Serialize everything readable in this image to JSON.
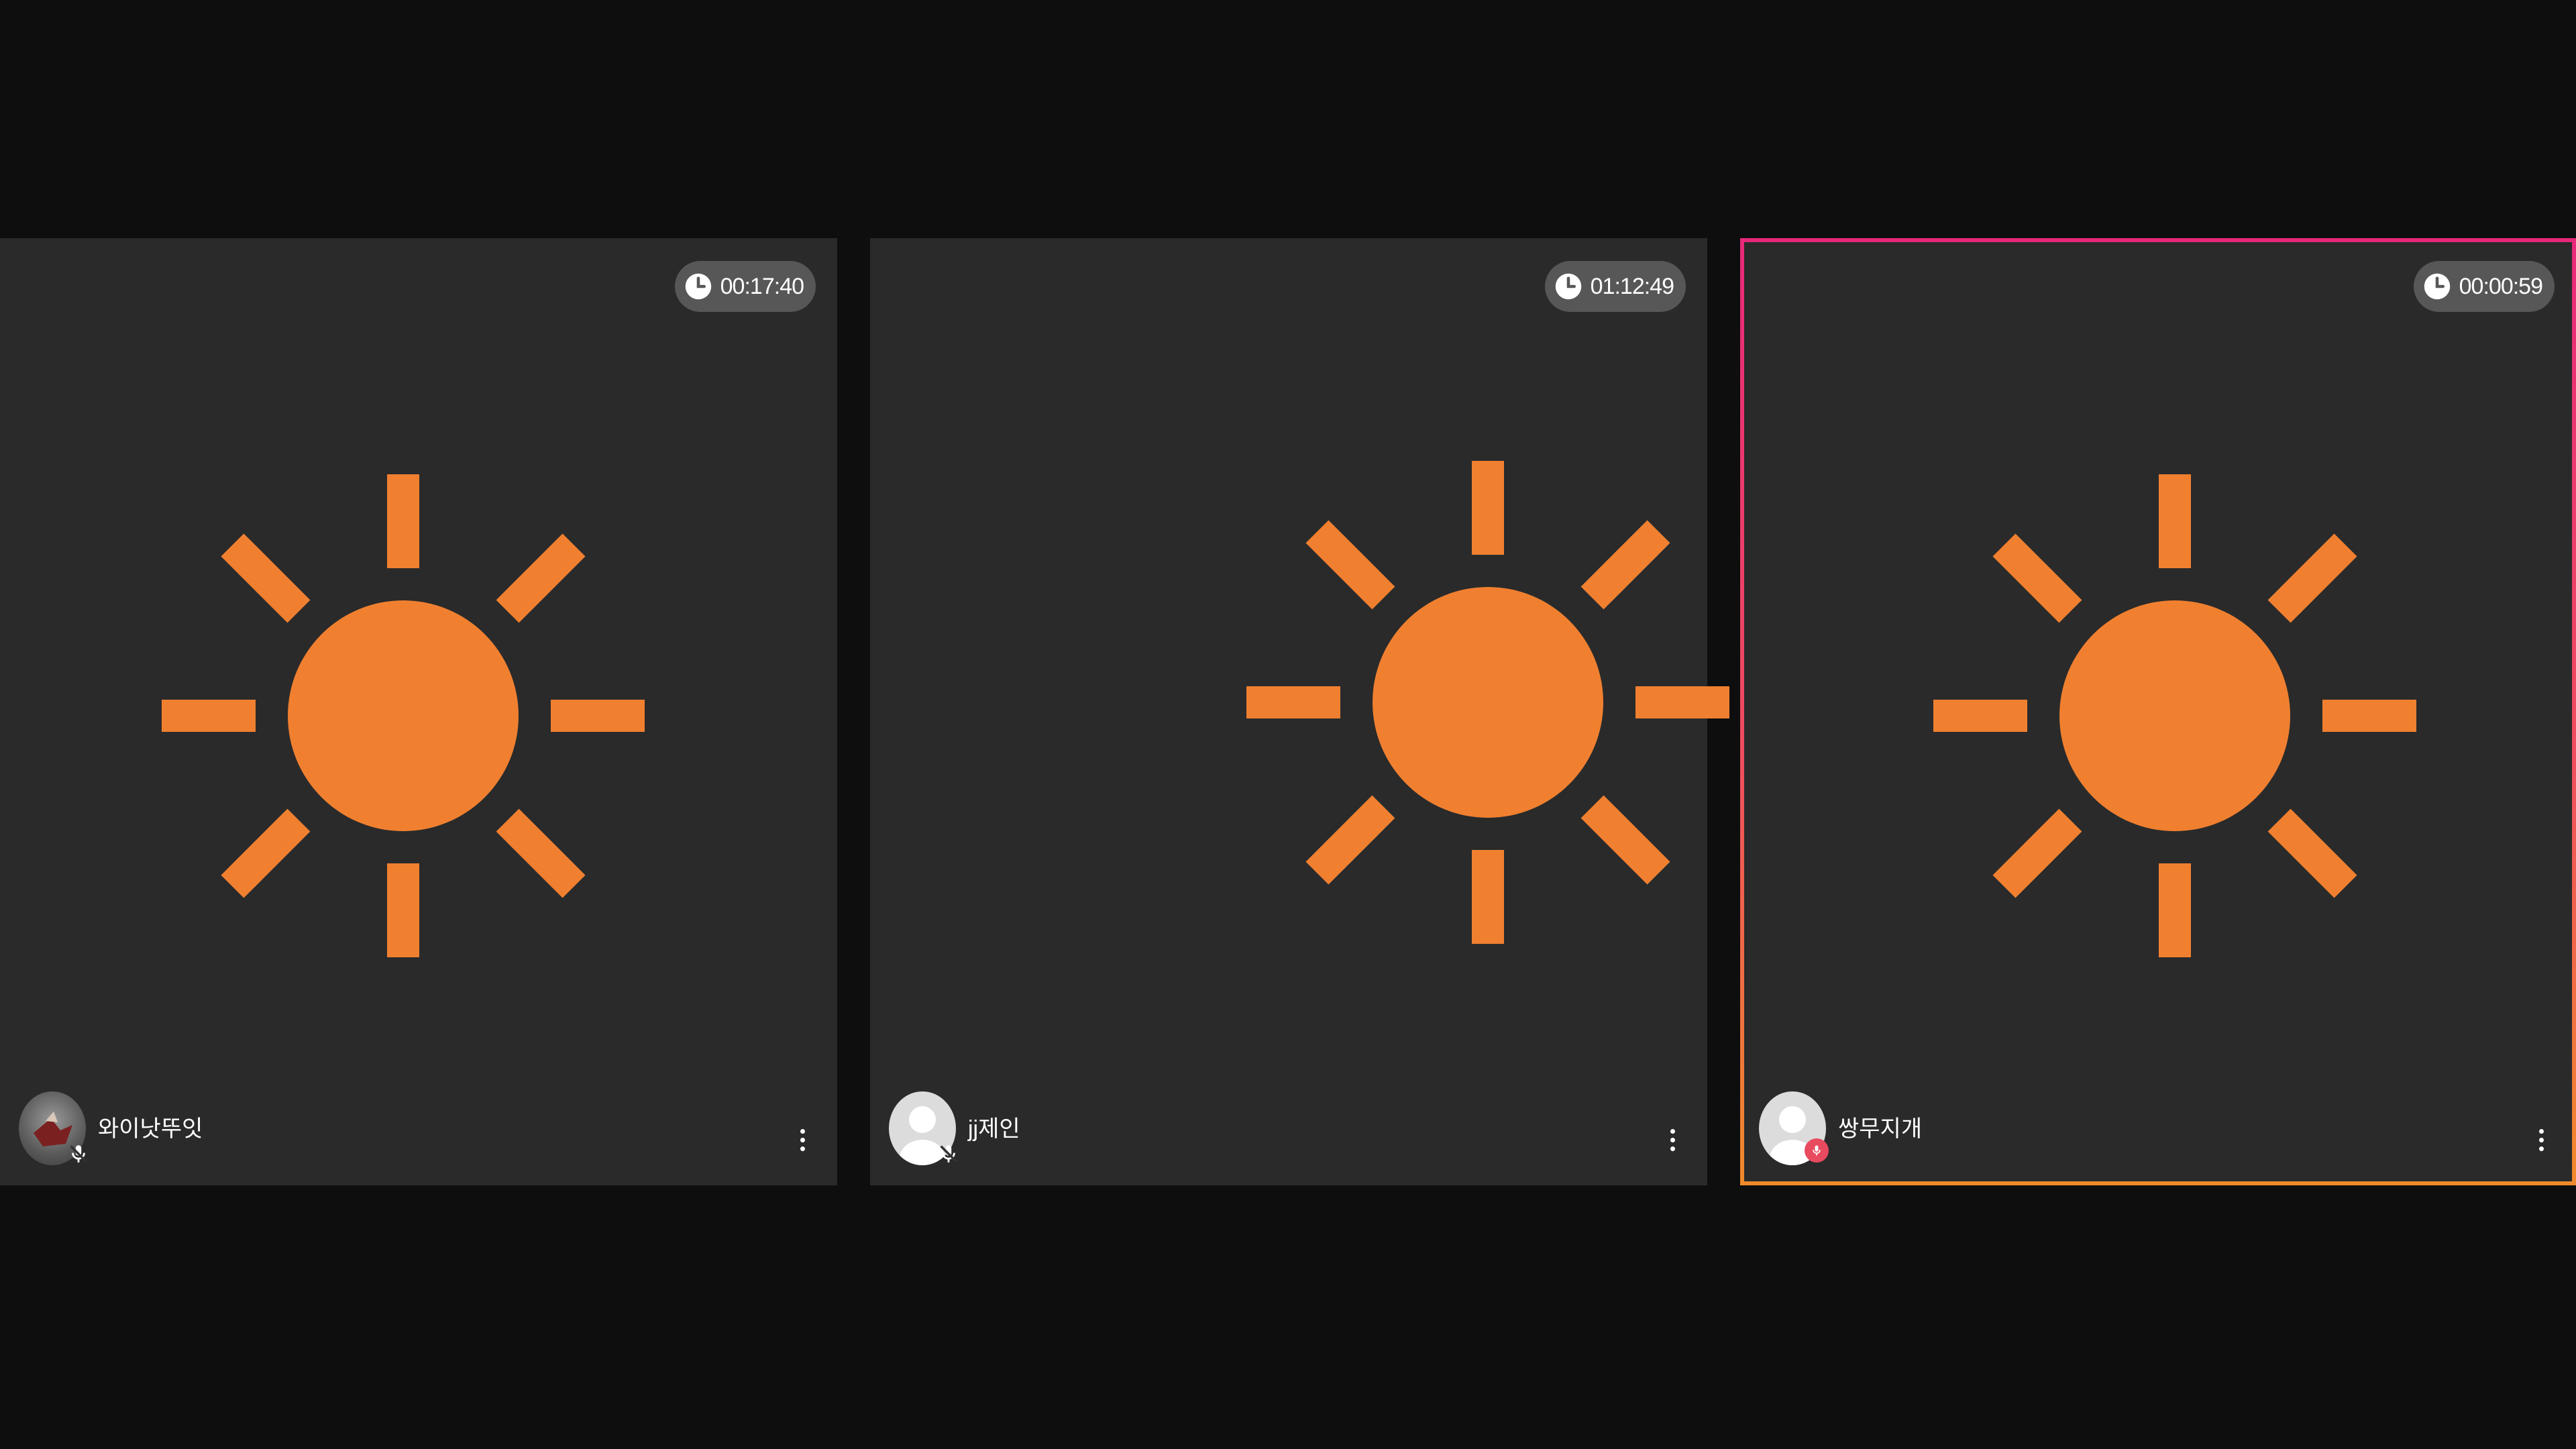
{
  "colors": {
    "background": "#0e0e0e",
    "tile": "#2a2a2a",
    "sun": "#f08030",
    "active_border_top": "#e8287a",
    "active_border_bottom": "#f08a2a",
    "timer_pill": "#575757"
  },
  "icons": {
    "timer": "clock-icon",
    "placeholder": "sun-icon",
    "mic_off": "mic-off-icon",
    "menu": "more-vertical-icon"
  },
  "tiles": [
    {
      "timer": "00:17:40",
      "username": "와이낫뚜잇",
      "active": false
    },
    {
      "timer": "01:12:49",
      "username": "jj제인",
      "active": false
    },
    {
      "timer": "00:00:59",
      "username": "쌍무지개",
      "active": true
    }
  ]
}
